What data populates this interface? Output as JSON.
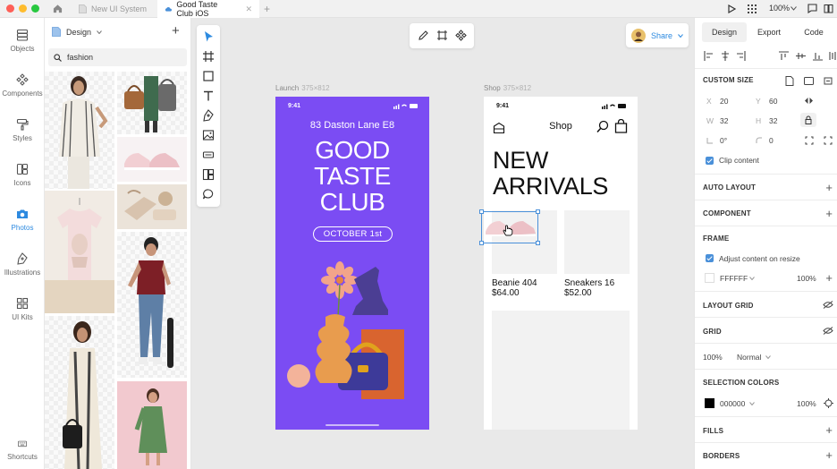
{
  "tabs": {
    "file1": "New UI System",
    "file2": "Good Taste Club iOS",
    "zoom": "100%"
  },
  "rail": {
    "objects": "Objects",
    "components": "Components",
    "styles": "Styles",
    "icons": "Icons",
    "photos": "Photos",
    "illustrations": "Illustrations",
    "ui_kits": "UI Kits",
    "shortcuts": "Shortcuts"
  },
  "library": {
    "dropdown": "Design",
    "search_value": "fashion"
  },
  "canvas": {
    "share_label": "Share",
    "launch_label": "Launch",
    "launch_dim": "375×812",
    "shop_label": "Shop",
    "shop_dim": "375×812"
  },
  "launch": {
    "time": "9:41",
    "address": "83 Daston Lane E8",
    "title_line1": "GOOD",
    "title_line2": "TASTE",
    "title_line3": "CLUB",
    "date_badge": "OCTOBER 1st"
  },
  "shop": {
    "time": "9:41",
    "header": "Shop",
    "headline_line1": "NEW",
    "headline_line2": "ARRIVALS",
    "product1_name": "Beanie 404",
    "product1_price": "$64.00",
    "product2_name": "Sneakers 16",
    "product2_price": "$52.00"
  },
  "panel": {
    "tab_design": "Design",
    "tab_export": "Export",
    "tab_code": "Code",
    "custom_size": "CUSTOM SIZE",
    "x_label": "X",
    "x_value": "20",
    "y_label": "Y",
    "y_value": "60",
    "w_label": "W",
    "w_value": "32",
    "h_label": "H",
    "h_value": "32",
    "rotation": "0°",
    "radius": "0",
    "clip_content": "Clip content",
    "auto_layout": "AUTO LAYOUT",
    "component": "COMPONENT",
    "frame": "FRAME",
    "adjust_content": "Adjust content on resize",
    "frame_color": "FFFFFF",
    "frame_opacity": "100%",
    "layout_grid": "LAYOUT GRID",
    "grid": "GRID",
    "layer_opacity": "100%",
    "blend_mode": "Normal",
    "selection_colors": "SELECTION COLORS",
    "sel_color": "000000",
    "sel_opacity": "100%",
    "fills": "FILLS",
    "borders": "BORDERS"
  },
  "colors": {
    "accent": "#2d8ae0",
    "launch_bg": "#7b4cf3"
  }
}
